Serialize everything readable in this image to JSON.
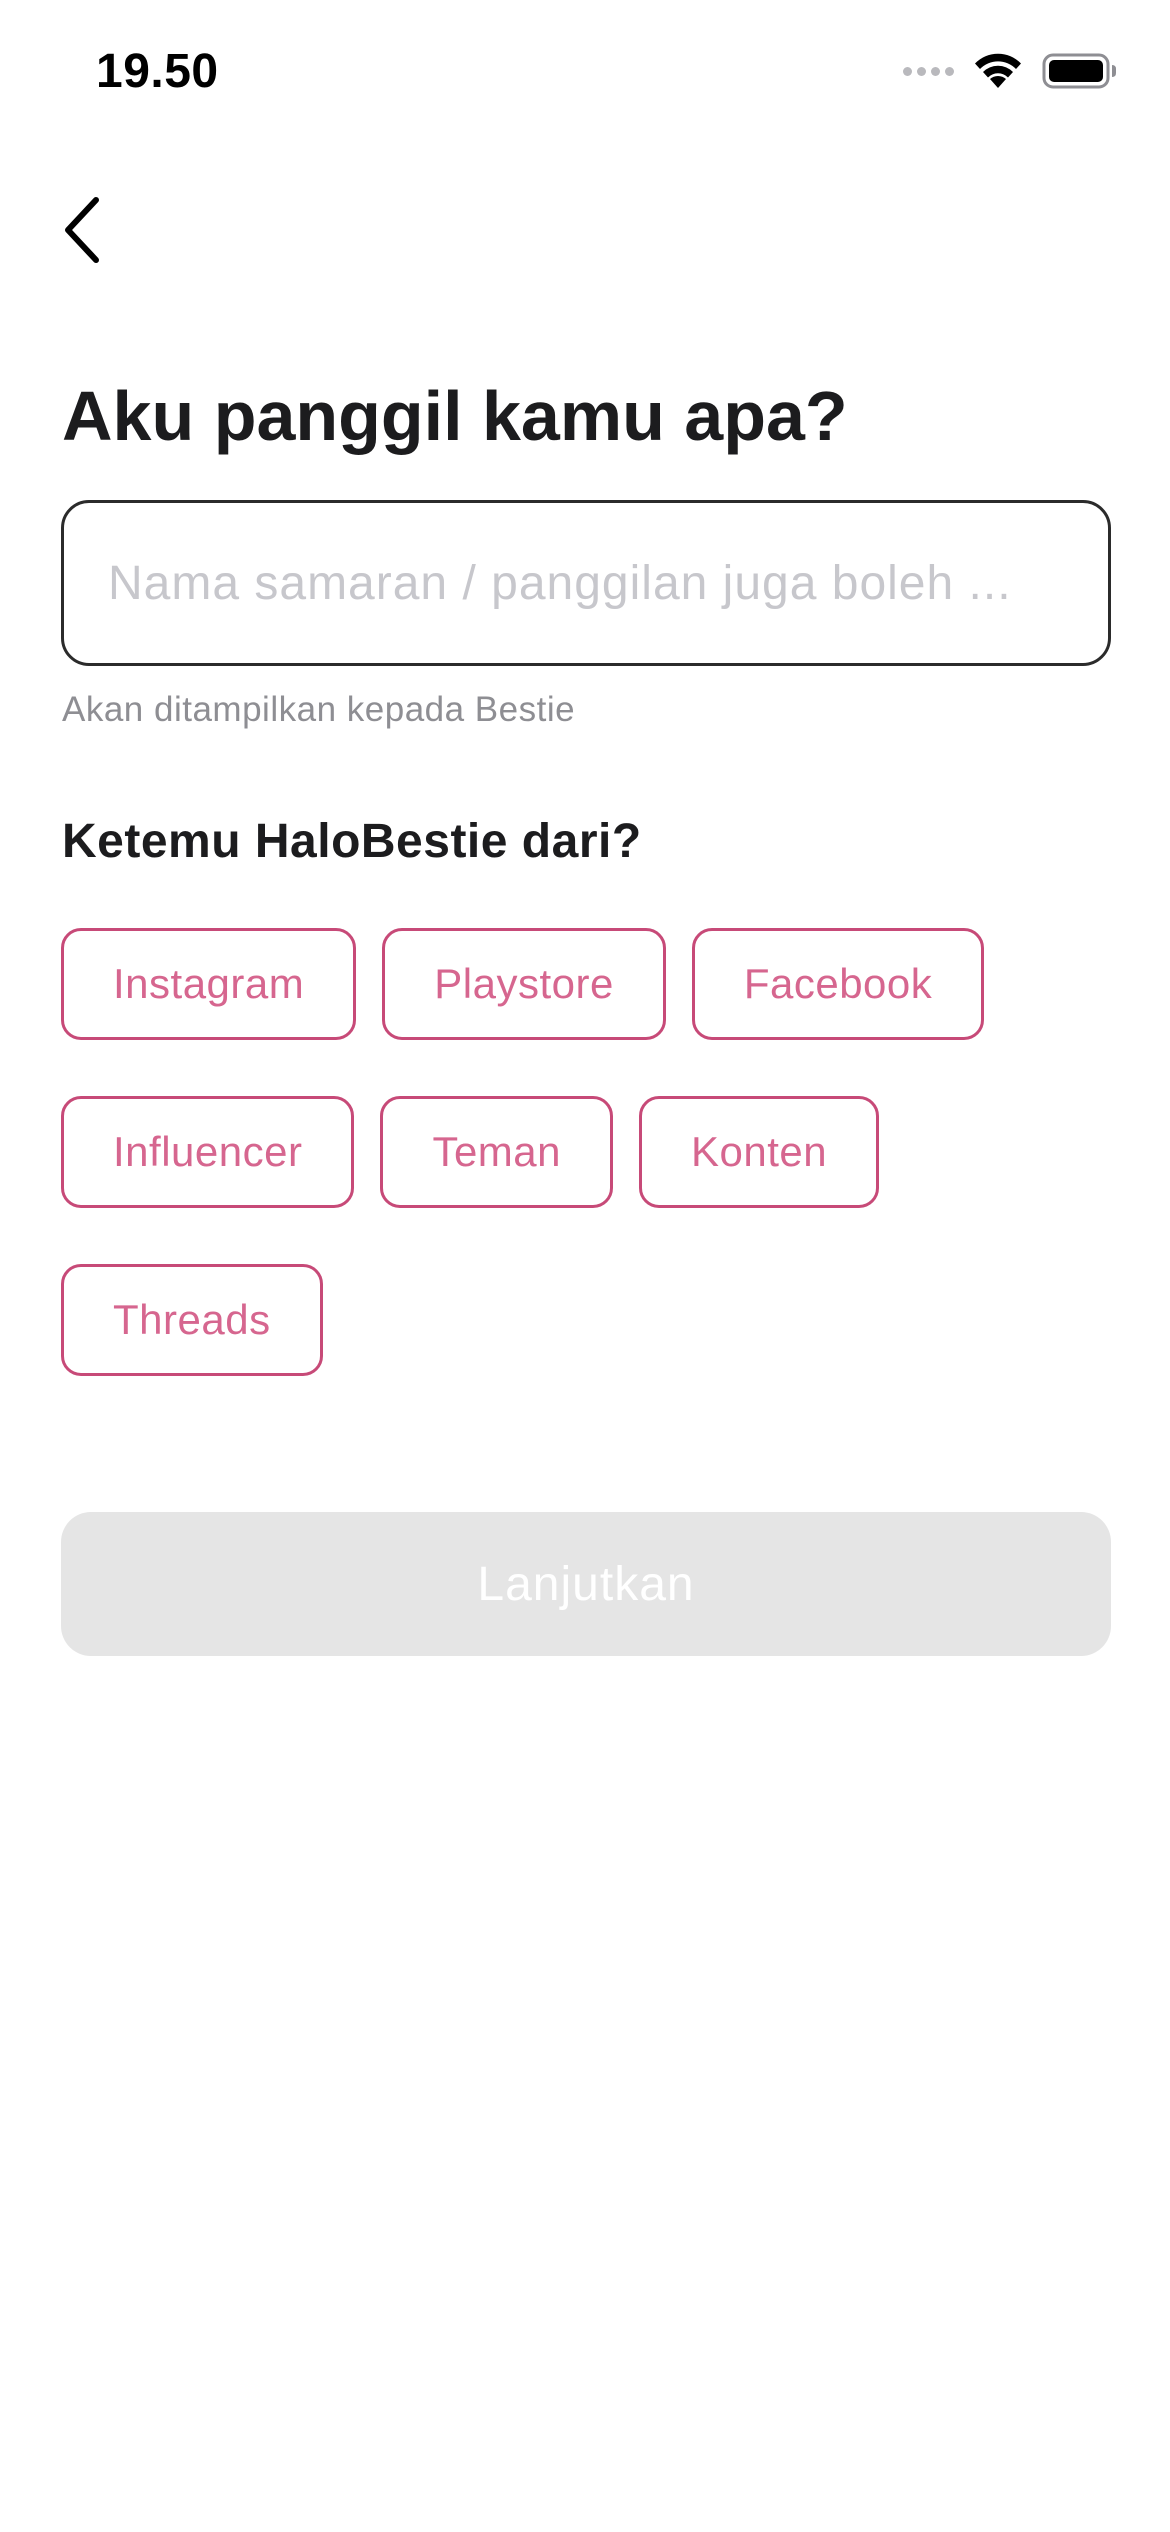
{
  "status_bar": {
    "time": "19.50",
    "icons": [
      "cellular-signal-icon",
      "wifi-icon",
      "battery-icon"
    ]
  },
  "header": {
    "back_icon": "chevron-left-icon"
  },
  "main": {
    "title": "Aku panggil kamu apa?",
    "name_input": {
      "value": "",
      "placeholder": "Nama samaran / panggilan juga boleh ..."
    },
    "helper_text": "Akan ditampilkan kepada Bestie",
    "source_question": "Ketemu HaloBestie dari?",
    "source_options": [
      [
        "Instagram",
        "Playstore",
        "Facebook"
      ],
      [
        "Influencer",
        "Teman",
        "Konten"
      ],
      [
        "Threads"
      ]
    ],
    "continue_label": "Lanjutkan"
  },
  "colors": {
    "accent": "#c74a78",
    "chip_text": "#d6668f",
    "button_disabled_bg": "#e5e5e5",
    "title_text": "#1c1c1e"
  }
}
